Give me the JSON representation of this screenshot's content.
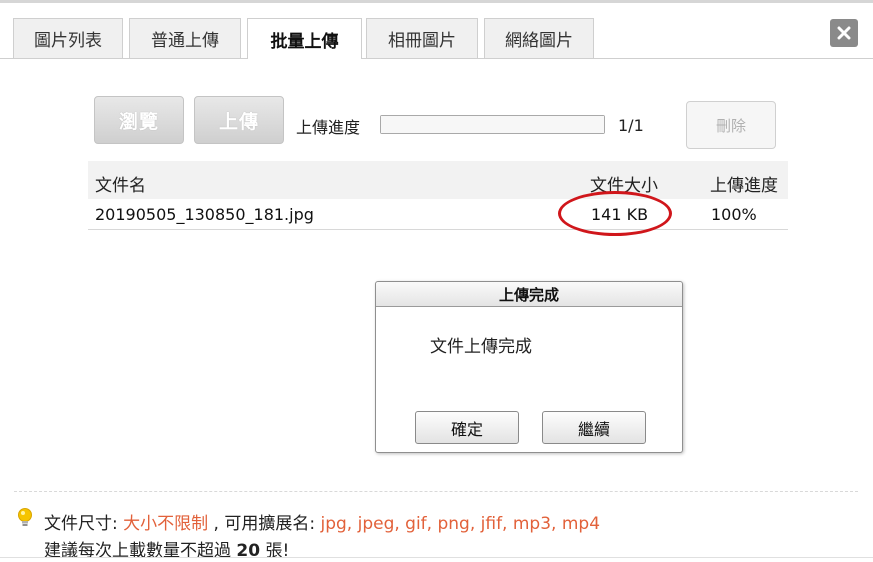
{
  "tabs": [
    {
      "label": "圖片列表",
      "active": false
    },
    {
      "label": "普通上傳",
      "active": false
    },
    {
      "label": "批量上傳",
      "active": true
    },
    {
      "label": "相冊圖片",
      "active": false
    },
    {
      "label": "網絡圖片",
      "active": false
    }
  ],
  "toolbar": {
    "browse_label": "瀏覽",
    "upload_label": "上傳",
    "progress_label": "上傳進度",
    "progress_count": "1/1",
    "delete_label": "刪除"
  },
  "table": {
    "headers": {
      "name": "文件名",
      "size": "文件大小",
      "progress": "上傳進度"
    },
    "rows": [
      {
        "name": "20190505_130850_181.jpg",
        "size": "141 KB",
        "progress": "100%"
      }
    ]
  },
  "dialog": {
    "title": "上傳完成",
    "message": "文件上傳完成",
    "ok_label": "確定",
    "continue_label": "繼續"
  },
  "info": {
    "size_label": "文件尺寸: ",
    "size_value": "大小不限制",
    "ext_label": " , 可用擴展名: ",
    "ext_value": "jpg, jpeg, gif, png, jfif, mp3, mp4",
    "advice_prefix": "建議每次上載數量不超過 ",
    "advice_number": "20",
    "advice_suffix": " 張!"
  },
  "colors": {
    "accent_orange": "#e2613a",
    "annotation_red": "#d0161b"
  }
}
